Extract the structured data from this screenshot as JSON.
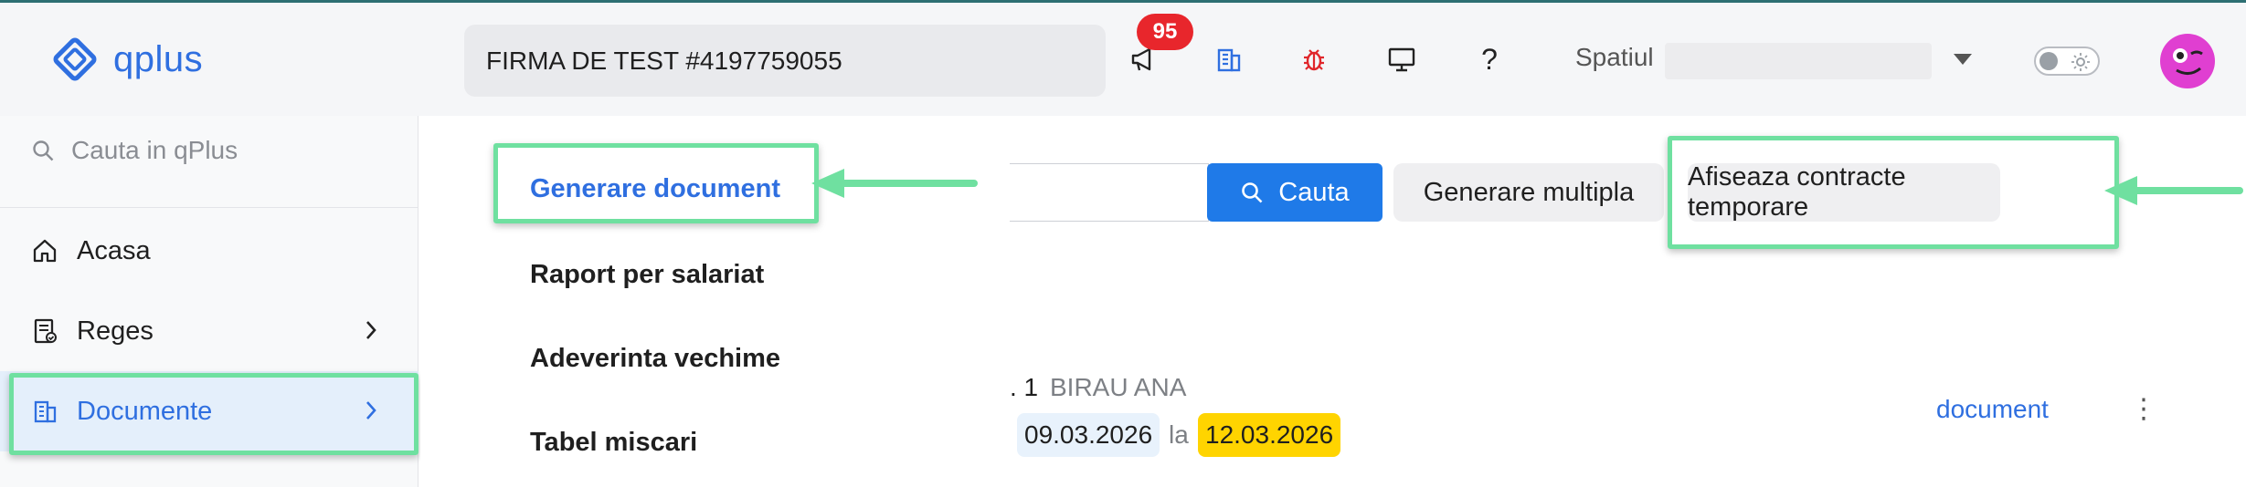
{
  "app": {
    "logo_text": "qplus"
  },
  "header": {
    "company": "FIRMA DE TEST #4197759055",
    "notifications_count": "95",
    "help_label": "?",
    "workspace_label": "Spatiul"
  },
  "sidebar": {
    "search_placeholder": "Cauta in qPlus",
    "items": [
      {
        "label": "Acasa",
        "icon": "home-icon"
      },
      {
        "label": "Reges",
        "icon": "document-check-icon"
      },
      {
        "label": "Documente",
        "icon": "building-icon"
      }
    ]
  },
  "submenu": {
    "items": [
      {
        "label": "Generare document"
      },
      {
        "label": "Raport per salariat"
      },
      {
        "label": "Adeverinta vechime"
      },
      {
        "label": "Tabel miscari"
      }
    ]
  },
  "toolbar": {
    "search_button": "Cauta",
    "multi_button": "Generare multipla",
    "temp_button": "Afiseaza contracte temporare"
  },
  "row": {
    "prefix": ". 1",
    "employee": "BIRAU ANA",
    "from_date": "09.03.2026",
    "separator": "la",
    "to_date": "12.03.2026",
    "link": "document",
    "menu_glyph": "⋮"
  },
  "colors": {
    "accent": "#2f6fe0",
    "highlight": "#6fe0a0",
    "badge": "#e8262c",
    "date_to": "#ffd400",
    "date_from": "#e8f2fc"
  }
}
